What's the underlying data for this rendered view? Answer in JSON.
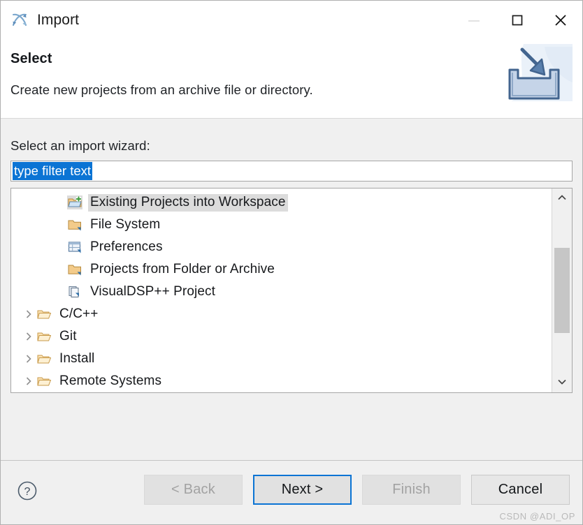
{
  "window": {
    "title": "Import",
    "app_icon": "import-arrows-icon",
    "controls": {
      "minimize": "minimize-icon",
      "maximize": "maximize-icon",
      "close": "close-icon"
    }
  },
  "header": {
    "title": "Select",
    "description": "Create new projects from an archive file or directory.",
    "banner_icon": "import-tray-icon"
  },
  "main": {
    "section_label": "Select an import wizard:",
    "filter": {
      "value": "type filter text",
      "placeholder": "type filter text",
      "selected": true
    },
    "tree": [
      {
        "label": "Existing Projects into Workspace",
        "icon": "folder-add-icon",
        "type": "leaf",
        "selected": true
      },
      {
        "label": "File System",
        "icon": "folder-icon",
        "type": "leaf",
        "selected": false
      },
      {
        "label": "Preferences",
        "icon": "preferences-table-icon",
        "type": "leaf",
        "selected": false
      },
      {
        "label": "Projects from Folder or Archive",
        "icon": "folder-icon",
        "type": "leaf",
        "selected": false
      },
      {
        "label": "VisualDSP++ Project",
        "icon": "project-pages-icon",
        "type": "leaf",
        "selected": false
      },
      {
        "label": "C/C++",
        "icon": "folder-open-icon",
        "type": "category",
        "expanded": false
      },
      {
        "label": "Git",
        "icon": "folder-open-icon",
        "type": "category",
        "expanded": false
      },
      {
        "label": "Install",
        "icon": "folder-open-icon",
        "type": "category",
        "expanded": false
      },
      {
        "label": "Remote Systems",
        "icon": "folder-open-icon",
        "type": "category",
        "expanded": false
      }
    ],
    "scrollbar": {
      "up_icon": "chevron-up-icon",
      "down_icon": "chevron-down-icon"
    }
  },
  "footer": {
    "help_icon": "help-question-icon",
    "buttons": [
      {
        "label": "< Back",
        "state": "disabled"
      },
      {
        "label": "Next >",
        "state": "focused"
      },
      {
        "label": "Finish",
        "state": "disabled"
      },
      {
        "label": "Cancel",
        "state": "enabled"
      }
    ]
  },
  "watermark": "CSDN @ADI_OP",
  "colors": {
    "accent": "#0b74d4",
    "selection_grey": "#dcdcdc",
    "dialog_bg": "#f0f0f0",
    "folder": "#e8b763"
  }
}
